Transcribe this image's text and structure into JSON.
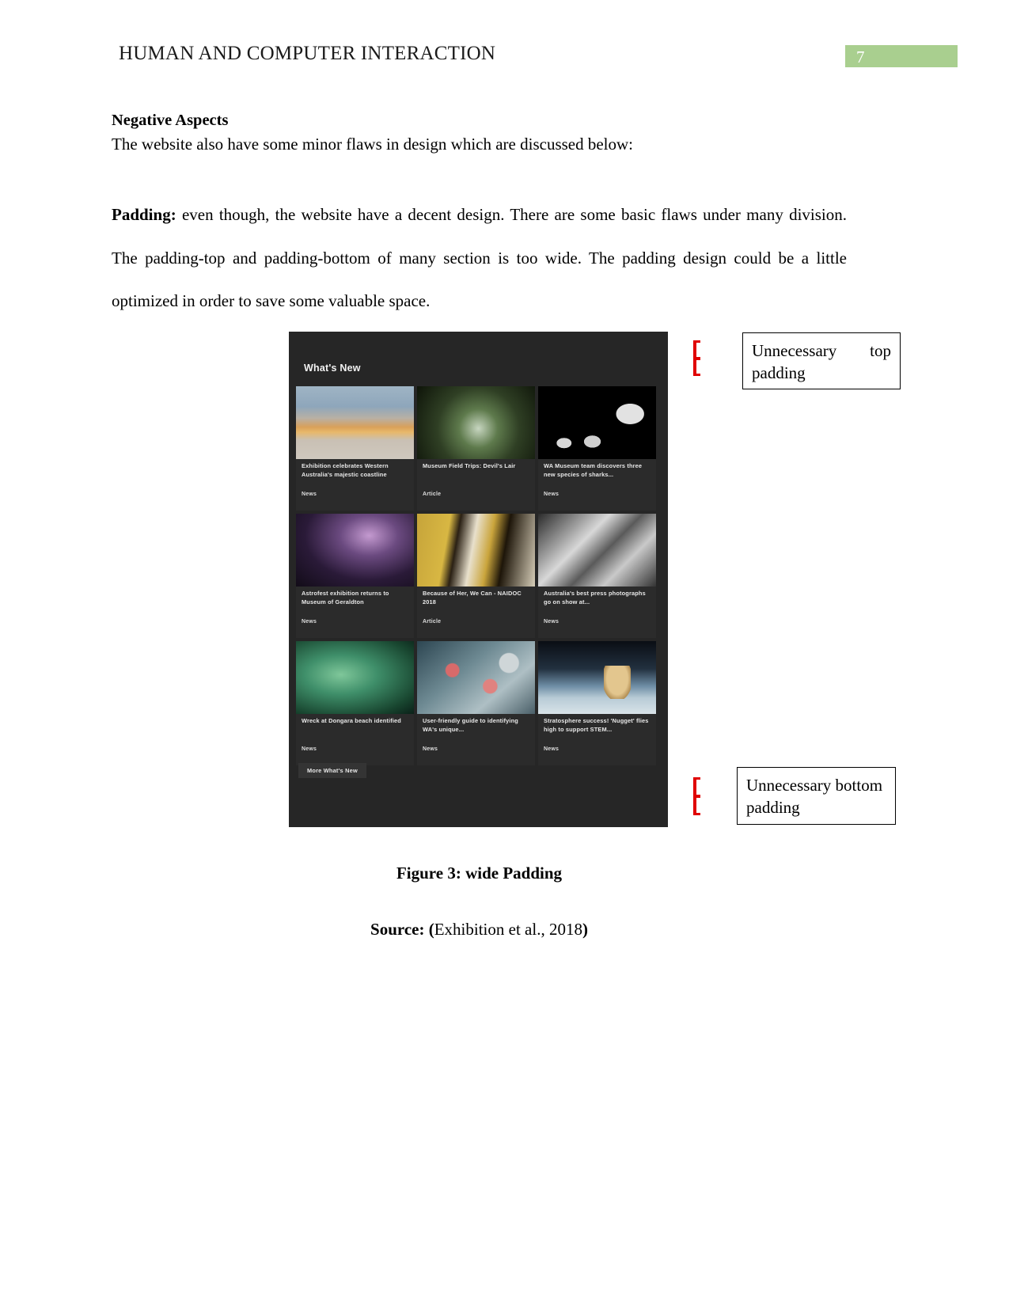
{
  "header": {
    "title": "HUMAN AND COMPUTER INTERACTION",
    "page_number": "7",
    "badge_color": "#a9cf8f"
  },
  "content": {
    "section_heading": "Negative Aspects",
    "intro_line": "The website also have some minor flaws in design which are discussed below:",
    "padding_label": "Padding:",
    "padding_body": " even though, the website have a decent design. There are some basic flaws under many division. The padding-top and padding-bottom of many section is too wide. The padding design could be a little optimized in order to save some valuable space."
  },
  "screenshot": {
    "heading": "What's New",
    "more_button": "More What's New",
    "cards": [
      {
        "caption": "Exhibition celebrates Western Australia's majestic coastline",
        "tag": "News",
        "art": "img-coast"
      },
      {
        "caption": "Museum Field Trips: Devil's Lair",
        "tag": "Article",
        "art": "img-cave"
      },
      {
        "caption": "WA Museum team discovers three new species of sharks...",
        "tag": "News",
        "art": "img-shark"
      },
      {
        "caption": "Astrofest exhibition returns to Museum of Geraldton",
        "tag": "News",
        "art": "img-astro"
      },
      {
        "caption": "Because of Her, We Can - NAIDOC 2018",
        "tag": "Article",
        "art": "img-naidoc"
      },
      {
        "caption": "Australia's best press photographs go on show at...",
        "tag": "News",
        "art": "img-press"
      },
      {
        "caption": "Wreck at Dongara beach identified",
        "tag": "News",
        "art": "img-wreck"
      },
      {
        "caption": "User-friendly guide to identifying WA's unique...",
        "tag": "News",
        "art": "img-coral"
      },
      {
        "caption": "Stratosphere success! 'Nugget' flies high to support STEM...",
        "tag": "News",
        "art": "img-bear"
      }
    ]
  },
  "annotations": {
    "marker_color": "#e00000",
    "top_callout": "Unnecessary   top padding",
    "bottom_callout": "Unnecessary bottom padding"
  },
  "figure": {
    "caption": "Figure 3: wide Padding",
    "source_label": "Source: (",
    "source_text": "Exhibition et al., 2018",
    "source_close": ")"
  }
}
